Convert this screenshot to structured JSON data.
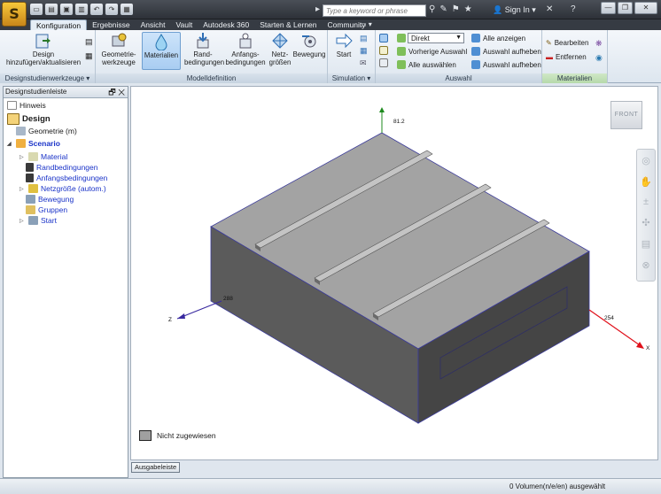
{
  "titlebar": {
    "app_letter": "S",
    "search_placeholder": "Type a keyword or phrase",
    "sign_in": "Sign In"
  },
  "tabs": [
    {
      "label": "Konfiguration",
      "active": true
    },
    {
      "label": "Ergebnisse"
    },
    {
      "label": "Ansicht"
    },
    {
      "label": "Vault"
    },
    {
      "label": "Autodesk 360"
    },
    {
      "label": "Starten & Lernen"
    },
    {
      "label": "Community"
    }
  ],
  "ribbon": {
    "design_panel": {
      "button": "Design hinzufügen/aktualisieren",
      "label": "Designstudienwerkzeuge"
    },
    "model_panel": {
      "label": "Modelldefinition",
      "buttons": [
        "Geometrie-werkzeuge",
        "Materialien",
        "Rand-bedingungen",
        "Anfangs-bedingungen",
        "Netz-größen",
        "Bewegung"
      ]
    },
    "sim_panel": {
      "label": "Simulation",
      "button": "Start"
    },
    "selection_panel": {
      "label": "Auswahl",
      "dropdown_value": "Direkt",
      "items": [
        "Vorherige Auswahl",
        "Alle auswählen",
        "Alle anzeigen",
        "Auswahl aufheben",
        "Auswahl aufheben"
      ]
    },
    "materials_panel": {
      "label": "Materialien",
      "items": [
        "Bearbeiten",
        "Entfernen"
      ]
    }
  },
  "browser": {
    "title": "Designstudienleiste",
    "nodes": [
      {
        "label": "Hinweis"
      },
      {
        "label": "Design"
      },
      {
        "label": "Geometrie (m)"
      },
      {
        "label": "Scenario"
      },
      {
        "label": "Material"
      },
      {
        "label": "Randbedingungen"
      },
      {
        "label": "Anfangsbedingungen"
      },
      {
        "label": "Netzgröße (autom.)"
      },
      {
        "label": "Bewegung"
      },
      {
        "label": "Gruppen"
      },
      {
        "label": "Start"
      }
    ]
  },
  "viewport": {
    "viewcube": "FRONT",
    "legend": "Nicht zugewiesen",
    "axes": {
      "y_label": "81.2",
      "z_label": "Z",
      "z_value": "288",
      "x_label": "X",
      "x_value": "254"
    },
    "colors": {
      "top_face": "#a3a3a3",
      "front_face": "#5b5b5b",
      "side_face": "#454545",
      "edge": "#3b3b9a",
      "x_axis": "#e0101a",
      "z_axis": "#3a2aa0",
      "y_axis": "#1d8a1d"
    }
  },
  "bottom": {
    "output_tab": "Ausgabeleiste",
    "status": "0 Volumen(n/e/en) ausgewählt"
  }
}
